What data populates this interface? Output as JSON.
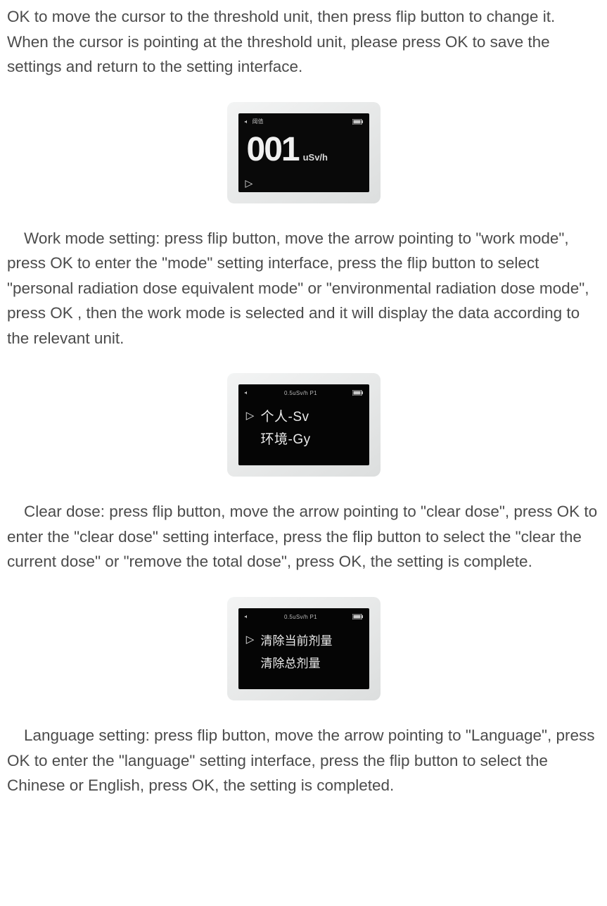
{
  "paragraphs": {
    "p1": "OK to move the cursor to the threshold unit, then press flip button to change it. When the cursor is pointing at the threshold unit, please press OK to save the settings and return to the setting interface.",
    "p2": "Work mode setting: press flip button, move the arrow pointing to \"work mode\", press OK to enter the \"mode\" setting interface, press the flip button to select \"personal radiation dose equivalent mode\" or \"environmental radiation dose mode\", press OK , then the work mode is selected and it will display the data according to the relevant unit.",
    "p3": "Clear dose: press flip button, move the arrow pointing to \"clear dose\", press OK to enter the \"clear dose\" setting interface, press the flip button to select the \"clear the current dose\" or \"remove the total dose\", press OK, the setting is complete.",
    "p4": "Language setting: press flip button, move the arrow pointing to \"Language\", press OK to enter the \"language\" setting interface, press the flip button to select the Chinese or English, press OK, the setting is completed."
  },
  "fig1": {
    "status_label": "阈值",
    "value": "001",
    "unit": "uSv/h",
    "cursor": "▷"
  },
  "fig2": {
    "status_label": "0.5uSv/h  P1",
    "line1": "个人-Sv",
    "line2": "环境-Gy"
  },
  "fig3": {
    "status_label": "0.5uSv/h  P1",
    "line1": "清除当前剂量",
    "line2": "清除总剂量"
  }
}
